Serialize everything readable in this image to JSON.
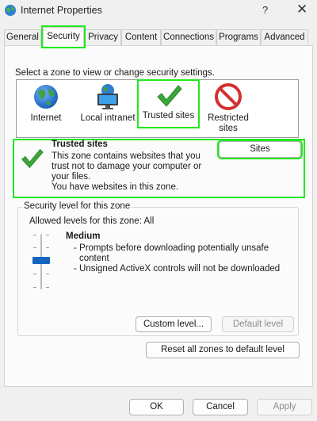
{
  "window": {
    "title": "Internet Properties",
    "help_glyph": "?",
    "close_glyph": "✕"
  },
  "tabs": [
    {
      "label": "General"
    },
    {
      "label": "Security",
      "active": true
    },
    {
      "label": "Privacy"
    },
    {
      "label": "Content"
    },
    {
      "label": "Connections"
    },
    {
      "label": "Programs"
    },
    {
      "label": "Advanced"
    }
  ],
  "security": {
    "zone_prompt": "Select a zone to view or change security settings.",
    "zones": [
      {
        "label": "Internet",
        "icon": "globe-icon"
      },
      {
        "label": "Local intranet",
        "icon": "monitor-globe-icon"
      },
      {
        "label": "Trusted sites",
        "icon": "green-check-icon",
        "selected": true
      },
      {
        "label": "Restricted sites",
        "icon": "no-entry-icon"
      }
    ],
    "zone_info": {
      "title": "Trusted sites",
      "description_lines": [
        "This zone contains websites that you",
        "trust not to damage your computer or",
        "your files.",
        "You have websites in this zone."
      ],
      "sites_button": "Sites"
    },
    "level_group": {
      "legend": "Security level for this zone",
      "allowed": "Allowed levels for this zone: All",
      "level_name": "Medium",
      "level_desc": [
        "- Prompts before downloading potentially unsafe",
        "content",
        "- Unsigned ActiveX controls will not be downloaded"
      ],
      "custom_button": "Custom level...",
      "default_button": "Default level"
    },
    "reset_all_button": "Reset all zones to default level"
  },
  "footer": {
    "ok": "OK",
    "cancel": "Cancel",
    "apply": "Apply"
  },
  "colors": {
    "accent": "#1565c0",
    "highlight": "#22e81e",
    "check_green": "#3aa63a",
    "restricted_red": "#d32f2f"
  }
}
